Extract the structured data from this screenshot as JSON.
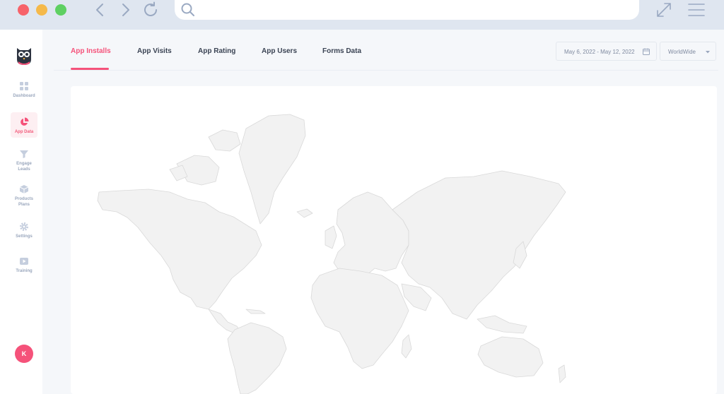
{
  "browser": {
    "url_placeholder": ""
  },
  "sidebar": {
    "items": [
      {
        "label": "Dashboard",
        "icon": "grid-icon"
      },
      {
        "label": "App Data",
        "icon": "pie-chart-icon",
        "active": true
      },
      {
        "label": "Engage Leads",
        "icon": "funnel-icon"
      },
      {
        "label": "Products Plans",
        "icon": "box-icon"
      },
      {
        "label": "Settings",
        "icon": "gear-icon"
      },
      {
        "label": "Training",
        "icon": "video-icon"
      }
    ],
    "avatar": "K"
  },
  "tabs": [
    {
      "label": "App Installs",
      "active": true
    },
    {
      "label": "App Visits"
    },
    {
      "label": "App Rating"
    },
    {
      "label": "App Users"
    },
    {
      "label": "Forms Data"
    }
  ],
  "filters": {
    "date_range": "May 6, 2022 - May 12, 2022",
    "region": "WorldWide"
  },
  "colors": {
    "accent": "#f5527a",
    "map_fill": "#f2f2f2",
    "map_stroke": "#d9d9d9"
  }
}
